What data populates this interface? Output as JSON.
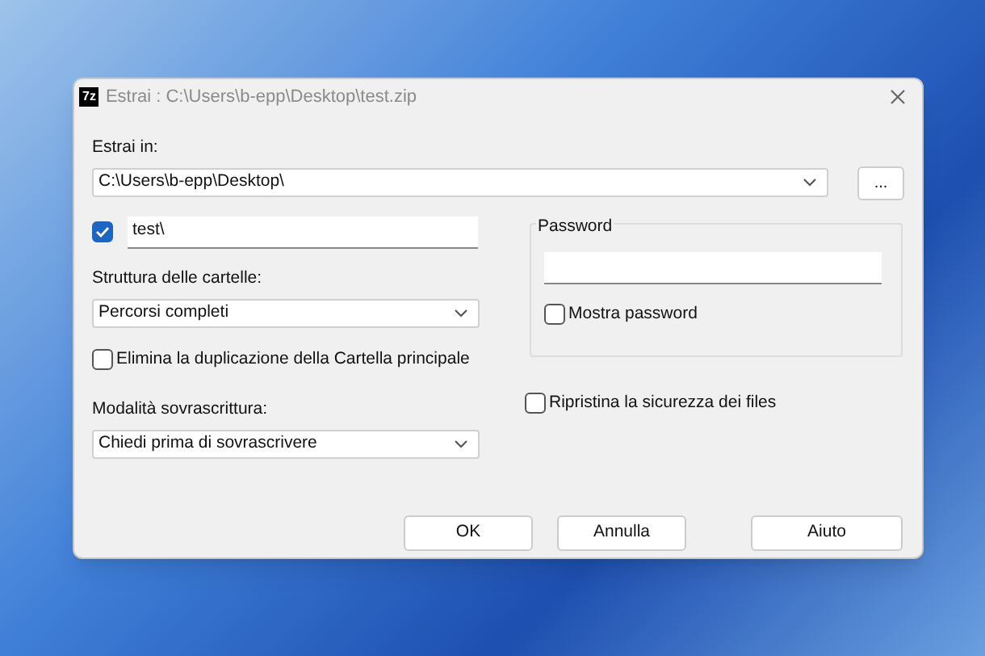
{
  "window": {
    "app_icon": "7z",
    "title": "Estrai : C:\\Users\\b-epp\\Desktop\\test.zip"
  },
  "extract_to": {
    "label": "Estrai in:",
    "value": "C:\\Users\\b-epp\\Desktop\\",
    "browse": "..."
  },
  "subfolder": {
    "checked": true,
    "value": "test\\"
  },
  "path_mode": {
    "label": "Struttura delle cartelle:",
    "value": "Percorsi completi"
  },
  "eliminate_duplication": {
    "label": "Elimina la duplicazione della Cartella principale",
    "checked": false
  },
  "overwrite_mode": {
    "label": "Modalità sovrascrittura:",
    "value": "Chiedi prima di sovrascrivere"
  },
  "password": {
    "group": "Password",
    "show_password": {
      "label": "Mostra password",
      "checked": false
    }
  },
  "restore_security": {
    "label": "Ripristina la sicurezza dei files",
    "checked": false
  },
  "buttons": [
    "OK",
    "Annulla",
    "Aiuto"
  ]
}
